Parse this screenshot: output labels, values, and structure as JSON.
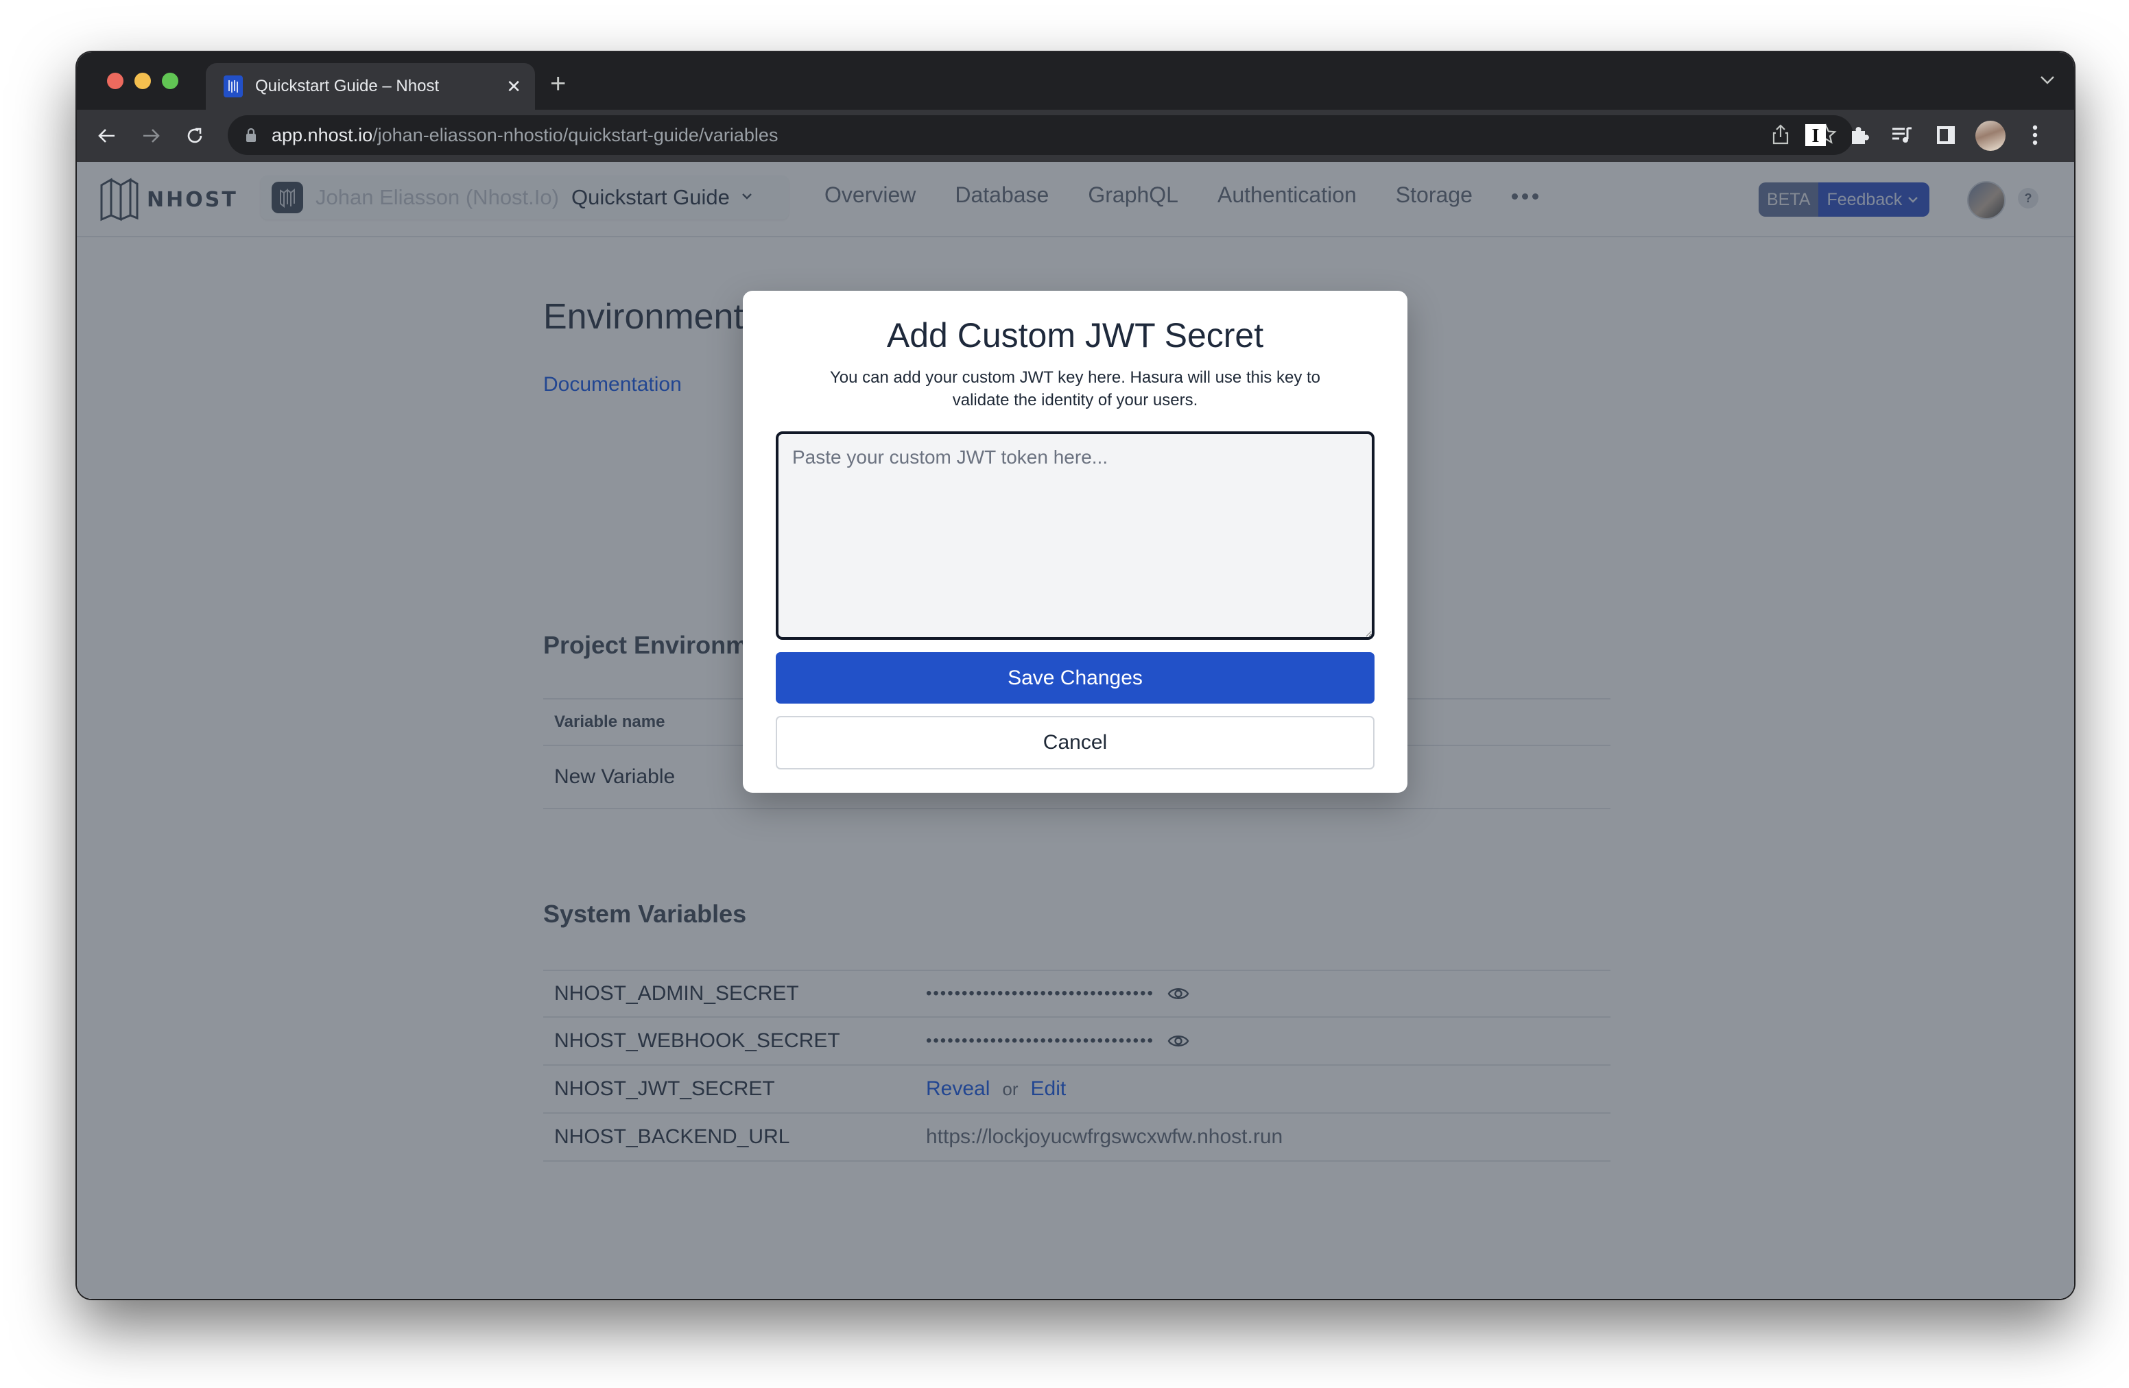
{
  "browser": {
    "tab": {
      "title": "Quickstart Guide – Nhost",
      "close_glyph": "✕"
    },
    "new_tab_glyph": "+",
    "url": {
      "host": "app.nhost.io",
      "path": "/johan-eliasson-nhostio/quickstart-guide/variables"
    },
    "icons": [
      "back-icon",
      "forward-icon",
      "reload-icon",
      "lock-icon",
      "share-icon",
      "bookmark-star-icon",
      "instapaper-extension-icon",
      "extensions-puzzle-icon",
      "media-control-icon",
      "side-panel-icon",
      "profile-avatar",
      "kebab-menu-icon",
      "tab-search-chevron-icon"
    ]
  },
  "app": {
    "logo_text": "NHOST",
    "workspace_name": "Johan Eliasson (Nhost.Io)",
    "project_name": "Quickstart Guide",
    "nav": [
      "Overview",
      "Database",
      "GraphQL",
      "Authentication",
      "Storage"
    ],
    "beta_label": "BETA",
    "feedback_label": "Feedback",
    "help_label": "?"
  },
  "page": {
    "title": "Environment Variables",
    "documentation_link": "Documentation",
    "project_env_title": "Project Environment Variables",
    "project_env_table": {
      "header": {
        "name": "Variable name"
      },
      "new_variable_link": "New Variable"
    },
    "system_vars_title": "System Variables",
    "system_vars": [
      {
        "name": "NHOST_ADMIN_SECRET",
        "value": "••••••••••••••••••••••••••••••••",
        "masked": true
      },
      {
        "name": "NHOST_WEBHOOK_SECRET",
        "value": "••••••••••••••••••••••••••••••••",
        "masked": true
      },
      {
        "name": "NHOST_JWT_SECRET",
        "reveal_label": "Reveal",
        "or_label": "or",
        "edit_label": "Edit"
      },
      {
        "name": "NHOST_BACKEND_URL",
        "value": "https://lockjoyucwfrgswcxwfw.nhost.run"
      }
    ]
  },
  "modal": {
    "title": "Add Custom JWT Secret",
    "description": "You can add your custom JWT key here. Hasura will use this key to validate the identity of your users.",
    "input": {
      "value": "",
      "placeholder": "Paste your custom JWT token here..."
    },
    "save_label": "Save Changes",
    "cancel_label": "Cancel"
  },
  "colors": {
    "primary": "#2251c8",
    "overlay": "rgba(31,41,55,0.5)",
    "link": "#2563eb"
  }
}
